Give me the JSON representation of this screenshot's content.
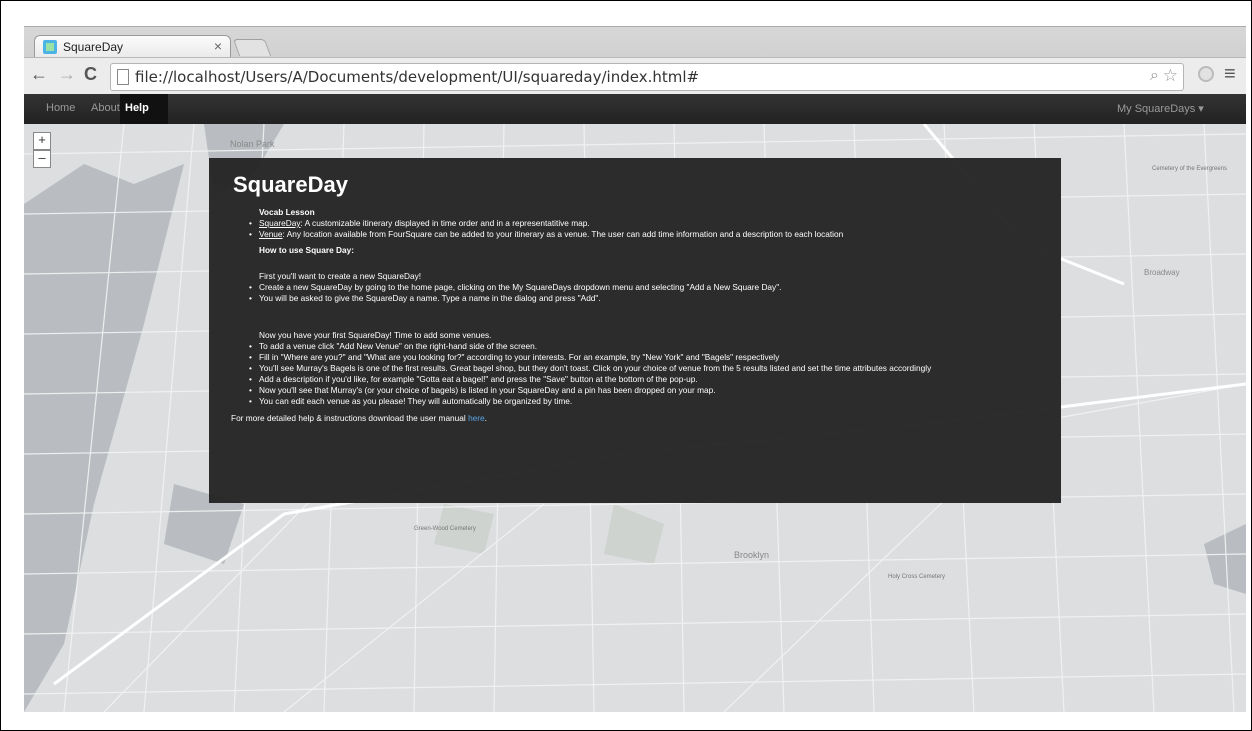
{
  "browser": {
    "tab_title": "SquareDay",
    "tab_close": "×",
    "url": "file://localhost/Users/A/Documents/development/UI/squareday/index.html#",
    "back": "←",
    "forward": "→",
    "reload": "C"
  },
  "navbar": {
    "home": "Home",
    "about": "About",
    "help": "Help",
    "my_squaredays": "My SquareDays ▾"
  },
  "map": {
    "zoom_in": "+",
    "zoom_out": "–",
    "labels": [
      "Nolan Park",
      "Green-Wood Cemetery",
      "Holy Cross Cemetery",
      "Cemetery of the Evergreens",
      "Brooklyn",
      "Broadway"
    ]
  },
  "help": {
    "title": "SquareDay",
    "vocab_heading": "Vocab Lesson",
    "vocab": [
      {
        "term": "SquareDay",
        "text": ": A customizable itinerary displayed in time order and in a representatitive map."
      },
      {
        "term": "Venue",
        "text": ": Any location available from FourSquare can be added to your itinerary as a venue. The user can add time information and a description to each location"
      }
    ],
    "howto_heading": "How to use Square Day:",
    "intro1": "First you'll want to create a new SquareDay!",
    "steps1": [
      "Create a new SquareDay by going to the home page, clicking on the My SquareDays dropdown menu and selecting \"Add a New Square Day\".",
      "You will be asked to give the SquareDay a name. Type a name in the dialog and press \"Add\"."
    ],
    "intro2": "Now you have your first SquareDay! Time to add some venues.",
    "steps2": [
      "To add a venue click \"Add New Venue\" on the right-hand side of the screen.",
      "Fill in \"Where are you?\" and \"What are you looking for?\" according to your interests. For an example, try \"New York\" and \"Bagels\" respectively",
      "You'll see Murray's Bagels is one of the first results. Great bagel shop, but they don't toast. Click on your choice of venue from the 5 results listed and set the time attributes accordingly",
      "Add a description if you'd like, for example \"Gotta eat a bagel!\" and press the \"Save\" button at the bottom of the pop-up.",
      "Now you'll see that Murray's (or your choice of bagels) is listed in your SquareDay and a pin has been dropped on your map.",
      "You can edit each venue as you please! They will automatically be organized by time."
    ],
    "footer_text": "For more detailed help & instructions download the user manual ",
    "footer_link": "here",
    "footer_end": "."
  }
}
